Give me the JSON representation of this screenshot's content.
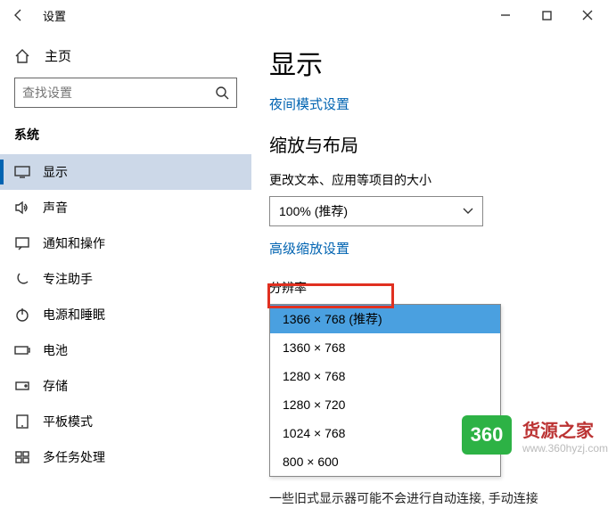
{
  "titlebar": {
    "title": "设置"
  },
  "sidebar": {
    "home_label": "主页",
    "search_placeholder": "查找设置",
    "category": "系统",
    "items": [
      {
        "label": "显示"
      },
      {
        "label": "声音"
      },
      {
        "label": "通知和操作"
      },
      {
        "label": "专注助手"
      },
      {
        "label": "电源和睡眠"
      },
      {
        "label": "电池"
      },
      {
        "label": "存储"
      },
      {
        "label": "平板模式"
      },
      {
        "label": "多任务处理"
      }
    ]
  },
  "main": {
    "heading": "显示",
    "night_light_link": "夜间模式设置",
    "scale_section_title": "缩放与布局",
    "scale_label": "更改文本、应用等项目的大小",
    "scale_value": "100% (推荐)",
    "advanced_scale_link": "高级缩放设置",
    "resolution_label": "分辨率",
    "resolution_options": [
      "1366 × 768 (推荐)",
      "1360 × 768",
      "1280 × 768",
      "1280 × 720",
      "1024 × 768",
      "800 × 600"
    ],
    "footnote": "一些旧式显示器可能不会进行自动连接, 手动连接"
  },
  "brand": {
    "badge": "360",
    "title": "货源之家",
    "url": "www.360hyzj.com"
  }
}
